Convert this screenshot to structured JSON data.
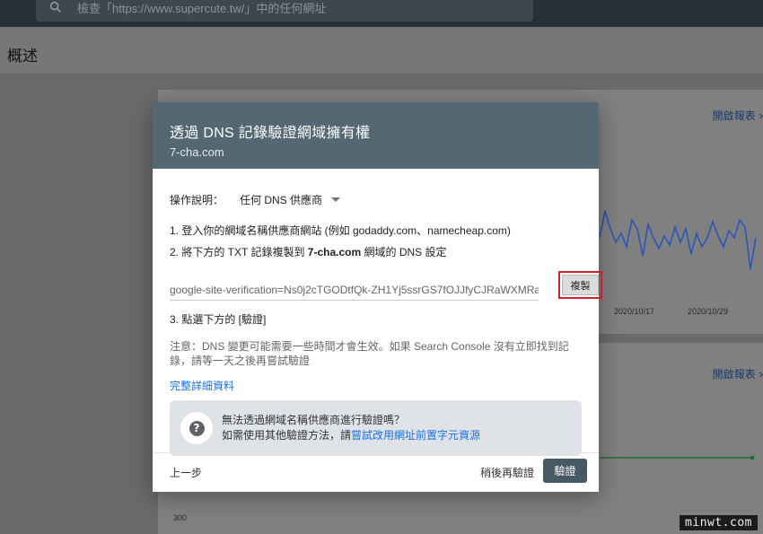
{
  "search": {
    "placeholder": "檢查「https://www.supercute.tw/」中的任何網址"
  },
  "page": {
    "title": "概述"
  },
  "cards": {
    "card1": {
      "open_report": "開啟報表",
      "dates": [
        "2020/10/17",
        "2020/10/29"
      ]
    },
    "card2": {
      "open_report": "開啟報表",
      "axis_value": "300"
    }
  },
  "modal": {
    "title": "透過 DNS 記錄驗證網域擁有權",
    "domain": "7-cha.com",
    "instructions_label": "操作說明：",
    "provider_selected": "任何 DNS 供應商",
    "step1": "1. 登入你的網域名稱供應商網站 (例如 godaddy.com、namecheap.com)",
    "step2_prefix": "2. 將下方的 TXT 記錄複製到 ",
    "step2_domain": "7-cha.com",
    "step2_suffix": " 網域的 DNS 設定",
    "txt_record": "google-site-verification=Ns0j2cTGODtfQk-ZH1Yj5ssrGS7fOJJfyCJRaWXMRa",
    "copy_label": "複製",
    "step3": "3. 點選下方的 [驗證]",
    "note": "注意：DNS 變更可能需要一些時間才會生效。如果 Search Console 沒有立即找到記錄，請等一天之後再嘗試驗證",
    "full_details_link": "完整詳細資料",
    "help": {
      "question": "無法透過網域名稱供應商進行驗證嗎？",
      "line2_prefix": "如需使用其他驗證方法，請",
      "line2_link": "嘗試改用網址前置字元資源"
    },
    "footer": {
      "prev": "上一步",
      "later": "稍後再驗證",
      "verify": "驗證"
    }
  },
  "watermark": "minwt.com",
  "colors": {
    "header": "#536873",
    "verify_button": "#455a64",
    "link": "#1a73e8",
    "highlight_border": "#d0202a",
    "chart_line": "#2a56b8",
    "chart_line2": "#1e6b3a"
  }
}
